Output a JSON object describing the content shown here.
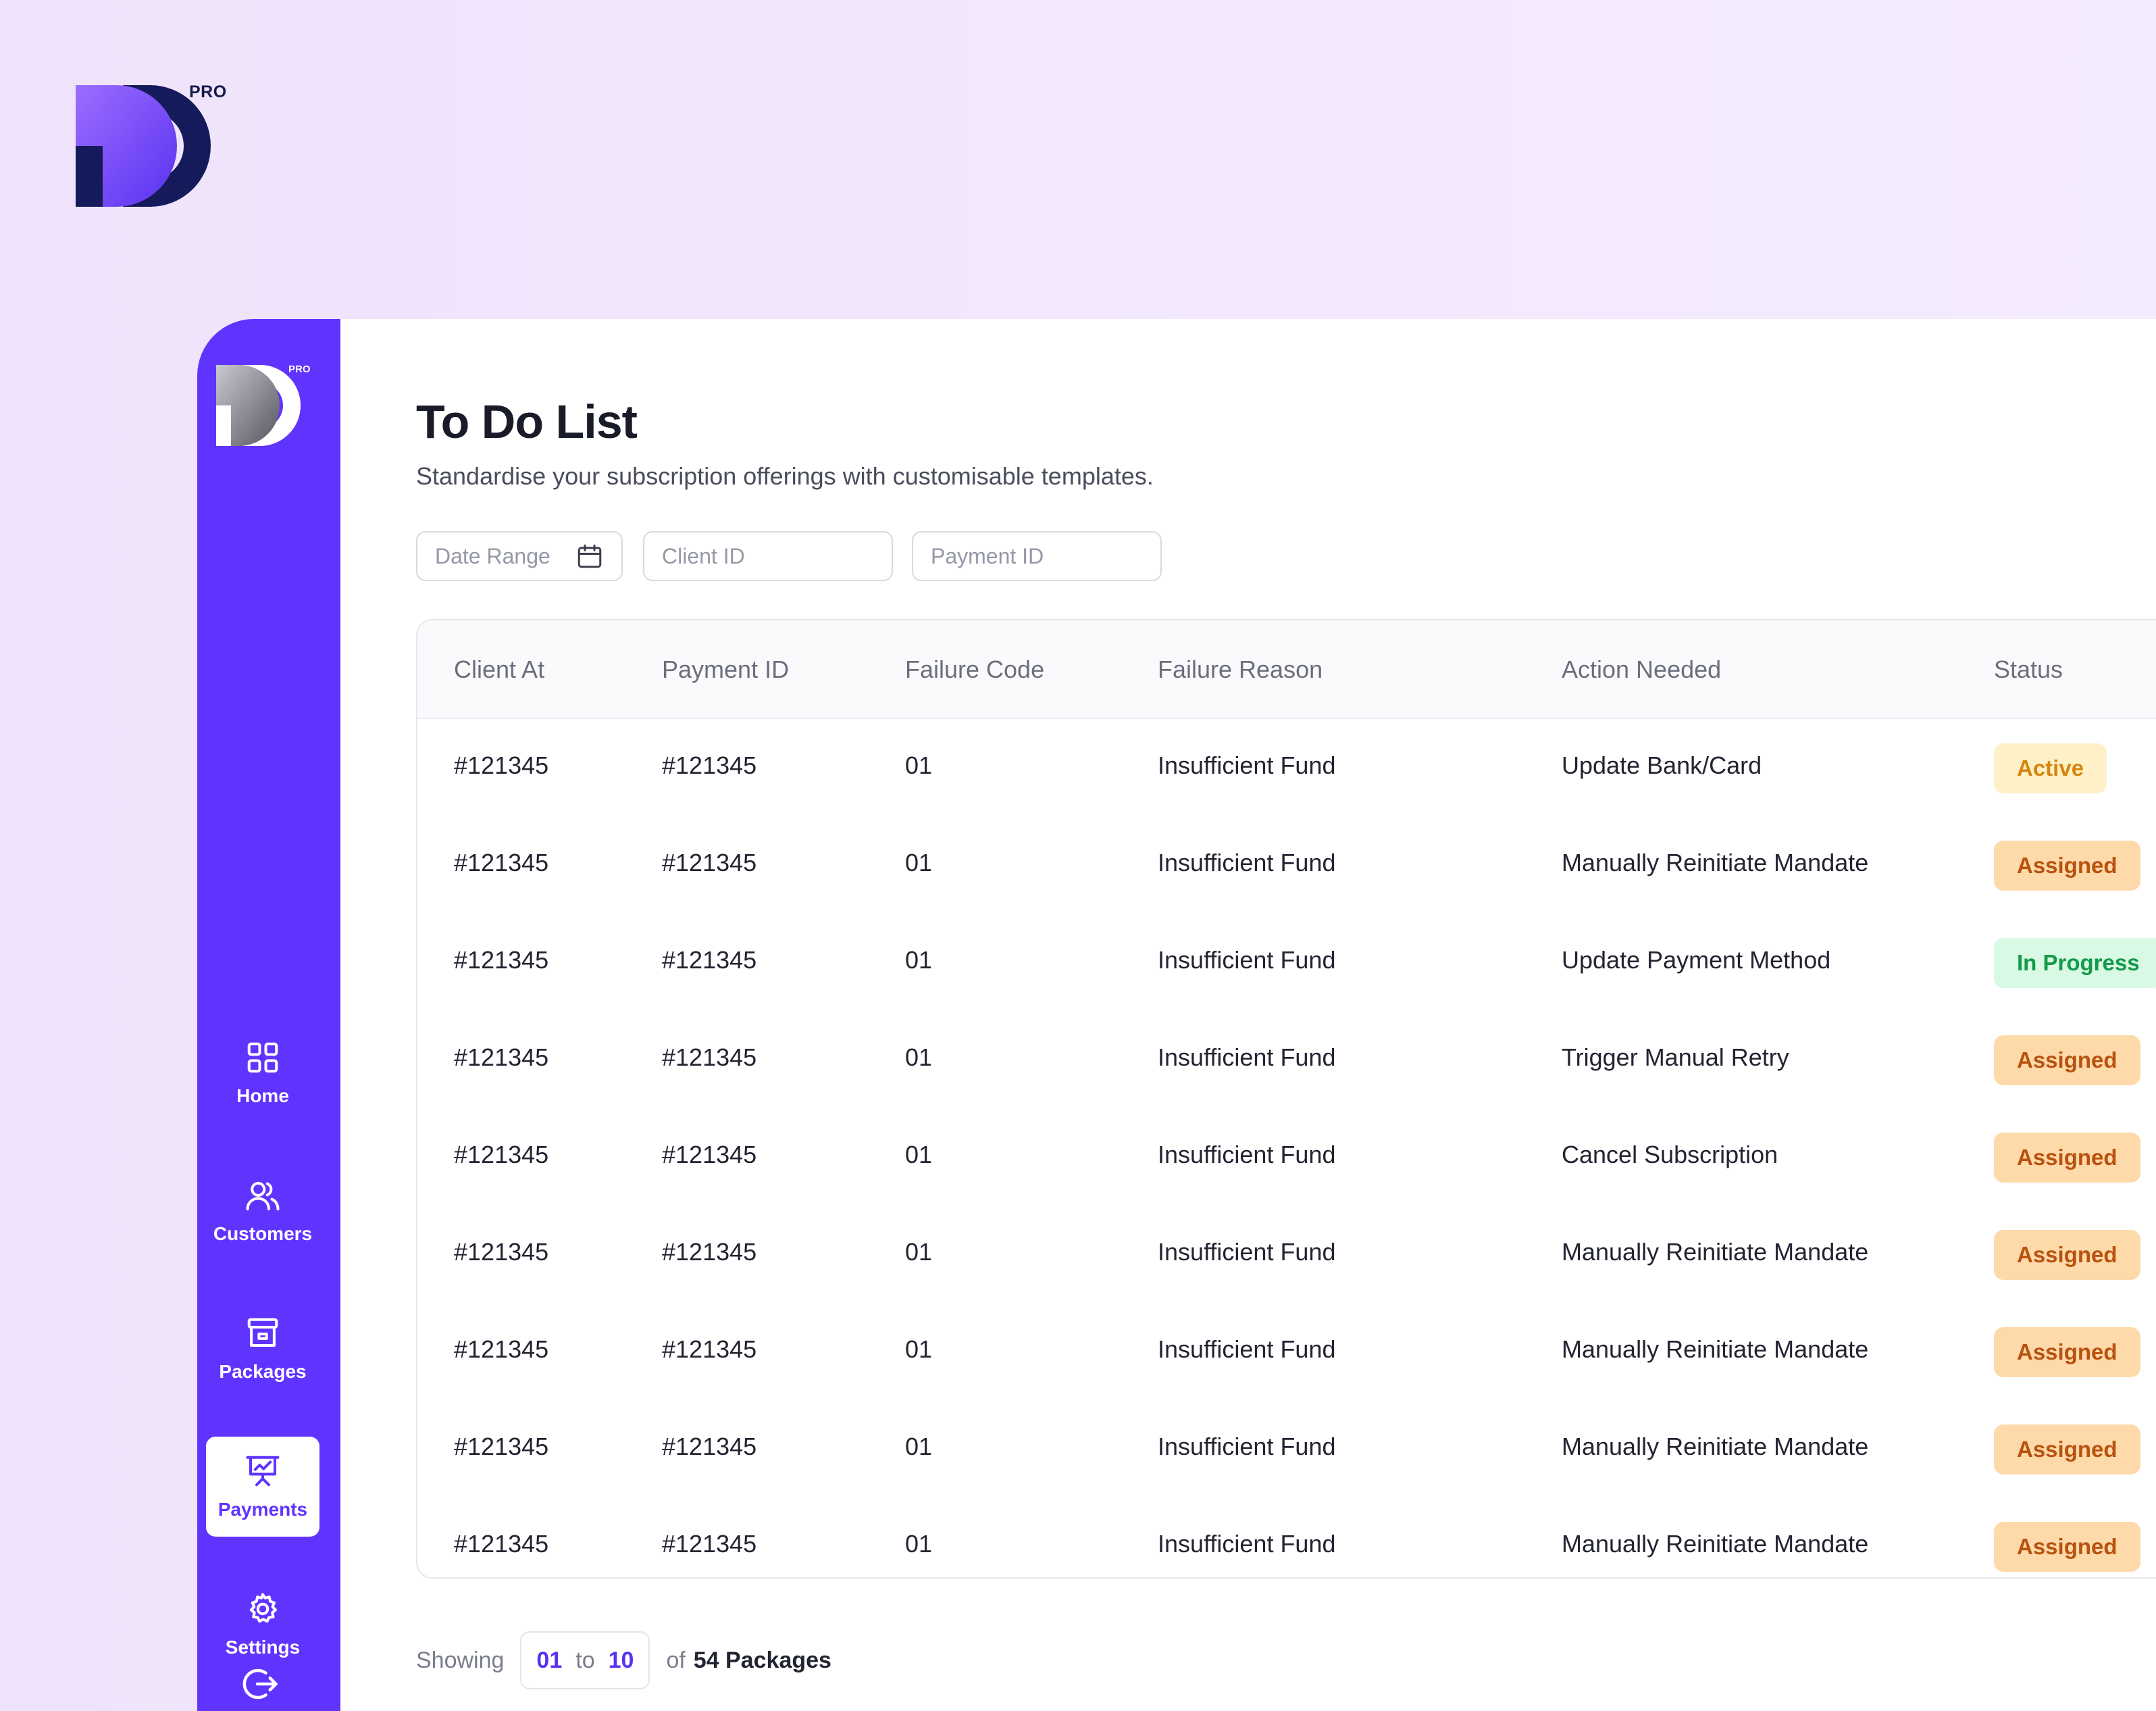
{
  "brand": {
    "badge": "PRO"
  },
  "sidebar": {
    "badge": "PRO",
    "items": [
      {
        "label": "Home",
        "icon": "grid-icon"
      },
      {
        "label": "Customers",
        "icon": "users-icon"
      },
      {
        "label": "Packages",
        "icon": "archive-icon"
      },
      {
        "label": "Payments",
        "icon": "presentation-chart-icon",
        "active": true
      },
      {
        "label": "Settings",
        "icon": "gear-icon"
      }
    ],
    "logout_icon": "logout-icon"
  },
  "header": {
    "title": "To Do List",
    "subtitle": "Standardise your subscription offerings with customisable templates."
  },
  "filters": {
    "date_range": "Date Range",
    "client_id_placeholder": "Client ID",
    "payment_id_placeholder": "Payment ID"
  },
  "table": {
    "columns": [
      "Client At",
      "Payment ID",
      "Failure Code",
      "Failure Reason",
      "Action Needed",
      "Status"
    ],
    "rows": [
      {
        "client": "#121345",
        "payment": "#121345",
        "code": "01",
        "reason": "Insufficient Fund",
        "action": "Update Bank/Card",
        "status": "Active",
        "status_type": "active"
      },
      {
        "client": "#121345",
        "payment": "#121345",
        "code": "01",
        "reason": "Insufficient Fund",
        "action": "Manually Reinitiate Mandate",
        "status": "Assigned",
        "status_type": "assigned"
      },
      {
        "client": "#121345",
        "payment": "#121345",
        "code": "01",
        "reason": "Insufficient Fund",
        "action": "Update Payment Method",
        "status": "In Progress",
        "status_type": "progress"
      },
      {
        "client": "#121345",
        "payment": "#121345",
        "code": "01",
        "reason": "Insufficient Fund",
        "action": "Trigger Manual Retry",
        "status": "Assigned",
        "status_type": "assigned"
      },
      {
        "client": "#121345",
        "payment": "#121345",
        "code": "01",
        "reason": "Insufficient Fund",
        "action": "Cancel Subscription",
        "status": "Assigned",
        "status_type": "assigned"
      },
      {
        "client": "#121345",
        "payment": "#121345",
        "code": "01",
        "reason": "Insufficient Fund",
        "action": "Manually Reinitiate Mandate",
        "status": "Assigned",
        "status_type": "assigned"
      },
      {
        "client": "#121345",
        "payment": "#121345",
        "code": "01",
        "reason": "Insufficient Fund",
        "action": "Manually Reinitiate Mandate",
        "status": "Assigned",
        "status_type": "assigned"
      },
      {
        "client": "#121345",
        "payment": "#121345",
        "code": "01",
        "reason": "Insufficient Fund",
        "action": "Manually Reinitiate Mandate",
        "status": "Assigned",
        "status_type": "assigned"
      },
      {
        "client": "#121345",
        "payment": "#121345",
        "code": "01",
        "reason": "Insufficient Fund",
        "action": "Manually Reinitiate Mandate",
        "status": "Assigned",
        "status_type": "assigned"
      }
    ]
  },
  "pagination": {
    "showing": "Showing",
    "from": "01",
    "to_label": "to",
    "to": "10",
    "of_label": "of",
    "total": "54 Packages",
    "prev_icon": "chevron-left-icon"
  },
  "colors": {
    "sidebar": "#6133ff",
    "active_badge": "#fff1c7",
    "assigned_badge": "#fed9aa",
    "progress_badge": "#d8f9e3"
  }
}
